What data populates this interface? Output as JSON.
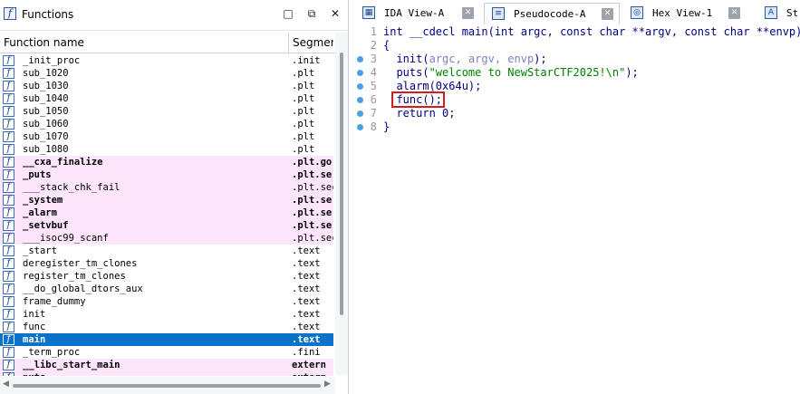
{
  "functions_window": {
    "title": "Functions",
    "buttons": {
      "maximize": "□",
      "restore": "⧉",
      "close": "✕"
    },
    "columns": {
      "name": "Function name",
      "segment": "Segmer"
    },
    "rows": [
      {
        "name": "_init_proc",
        "segment": ".init",
        "style": "normal"
      },
      {
        "name": "sub_1020",
        "segment": ".plt",
        "style": "normal"
      },
      {
        "name": "sub_1030",
        "segment": ".plt",
        "style": "normal"
      },
      {
        "name": "sub_1040",
        "segment": ".plt",
        "style": "normal"
      },
      {
        "name": "sub_1050",
        "segment": ".plt",
        "style": "normal"
      },
      {
        "name": "sub_1060",
        "segment": ".plt",
        "style": "normal"
      },
      {
        "name": "sub_1070",
        "segment": ".plt",
        "style": "normal"
      },
      {
        "name": "sub_1080",
        "segment": ".plt",
        "style": "normal"
      },
      {
        "name": "__cxa_finalize",
        "segment": ".plt.go",
        "style": "lib"
      },
      {
        "name": "_puts",
        "segment": ".plt.se",
        "style": "lib"
      },
      {
        "name": "___stack_chk_fail",
        "segment": ".plt.sec",
        "style": "lib-light"
      },
      {
        "name": "_system",
        "segment": ".plt.se",
        "style": "lib"
      },
      {
        "name": "_alarm",
        "segment": ".plt.se",
        "style": "lib"
      },
      {
        "name": "_setvbuf",
        "segment": ".plt.se",
        "style": "lib"
      },
      {
        "name": "___isoc99_scanf",
        "segment": ".plt.sec",
        "style": "lib-light"
      },
      {
        "name": "_start",
        "segment": ".text",
        "style": "normal"
      },
      {
        "name": "deregister_tm_clones",
        "segment": ".text",
        "style": "normal"
      },
      {
        "name": "register_tm_clones",
        "segment": ".text",
        "style": "normal"
      },
      {
        "name": "__do_global_dtors_aux",
        "segment": ".text",
        "style": "normal"
      },
      {
        "name": "frame_dummy",
        "segment": ".text",
        "style": "normal"
      },
      {
        "name": "init",
        "segment": ".text",
        "style": "normal"
      },
      {
        "name": "func",
        "segment": ".text",
        "style": "normal"
      },
      {
        "name": "main",
        "segment": ".text",
        "style": "selected"
      },
      {
        "name": "_term_proc",
        "segment": ".fini",
        "style": "normal"
      },
      {
        "name": "__libc_start_main",
        "segment": "extern",
        "style": "lib"
      },
      {
        "name": "puts",
        "segment": "extern",
        "style": "lib"
      }
    ]
  },
  "tabs": [
    {
      "label": "IDA View-A",
      "icon": "graph-view-icon",
      "active": false
    },
    {
      "label": "Pseudocode-A",
      "icon": "pseudocode-icon",
      "active": true
    },
    {
      "label": "Hex View-1",
      "icon": "hex-view-icon",
      "active": false
    },
    {
      "label": "St",
      "icon": "structures-icon",
      "active": false
    }
  ],
  "pseudocode": [
    {
      "num": "1",
      "bp": false
    },
    {
      "num": "2",
      "bp": false
    },
    {
      "num": "3",
      "bp": true
    },
    {
      "num": "4",
      "bp": true
    },
    {
      "num": "5",
      "bp": true
    },
    {
      "num": "6",
      "bp": true
    },
    {
      "num": "7",
      "bp": true
    },
    {
      "num": "8",
      "bp": true
    }
  ],
  "code_text": {
    "l1": "int __cdecl main(int argc, const char **argv, const char **envp)",
    "l2": "{",
    "l3_fn": "  init(",
    "l3_args": "argc, argv, envp",
    "l3_end": ");",
    "l4_fn": "  puts(",
    "l4_str": "\"welcome to NewStarCTF2025!\\n\"",
    "l4_end": ");",
    "l5": "  alarm(0x64u);",
    "l6": "  func();",
    "l7": "  return 0;",
    "l8": "}"
  },
  "colors": {
    "selection": "#0a73c9",
    "library_highlight": "#fde6fb",
    "annotation_box": "#d71c1c",
    "breakpoint_dot": "#4aa3e0"
  }
}
